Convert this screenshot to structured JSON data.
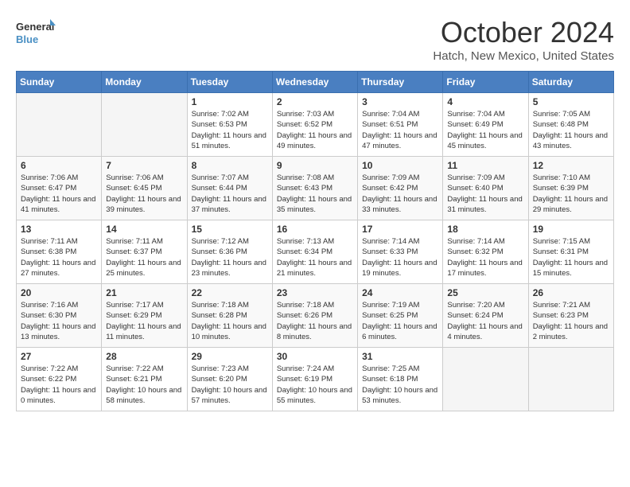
{
  "header": {
    "logo_line1": "General",
    "logo_line2": "Blue",
    "month": "October 2024",
    "location": "Hatch, New Mexico, United States"
  },
  "weekdays": [
    "Sunday",
    "Monday",
    "Tuesday",
    "Wednesday",
    "Thursday",
    "Friday",
    "Saturday"
  ],
  "weeks": [
    [
      {
        "day": "",
        "empty": true
      },
      {
        "day": "",
        "empty": true
      },
      {
        "day": "1",
        "sunrise": "Sunrise: 7:02 AM",
        "sunset": "Sunset: 6:53 PM",
        "daylight": "Daylight: 11 hours and 51 minutes."
      },
      {
        "day": "2",
        "sunrise": "Sunrise: 7:03 AM",
        "sunset": "Sunset: 6:52 PM",
        "daylight": "Daylight: 11 hours and 49 minutes."
      },
      {
        "day": "3",
        "sunrise": "Sunrise: 7:04 AM",
        "sunset": "Sunset: 6:51 PM",
        "daylight": "Daylight: 11 hours and 47 minutes."
      },
      {
        "day": "4",
        "sunrise": "Sunrise: 7:04 AM",
        "sunset": "Sunset: 6:49 PM",
        "daylight": "Daylight: 11 hours and 45 minutes."
      },
      {
        "day": "5",
        "sunrise": "Sunrise: 7:05 AM",
        "sunset": "Sunset: 6:48 PM",
        "daylight": "Daylight: 11 hours and 43 minutes."
      }
    ],
    [
      {
        "day": "6",
        "sunrise": "Sunrise: 7:06 AM",
        "sunset": "Sunset: 6:47 PM",
        "daylight": "Daylight: 11 hours and 41 minutes."
      },
      {
        "day": "7",
        "sunrise": "Sunrise: 7:06 AM",
        "sunset": "Sunset: 6:45 PM",
        "daylight": "Daylight: 11 hours and 39 minutes."
      },
      {
        "day": "8",
        "sunrise": "Sunrise: 7:07 AM",
        "sunset": "Sunset: 6:44 PM",
        "daylight": "Daylight: 11 hours and 37 minutes."
      },
      {
        "day": "9",
        "sunrise": "Sunrise: 7:08 AM",
        "sunset": "Sunset: 6:43 PM",
        "daylight": "Daylight: 11 hours and 35 minutes."
      },
      {
        "day": "10",
        "sunrise": "Sunrise: 7:09 AM",
        "sunset": "Sunset: 6:42 PM",
        "daylight": "Daylight: 11 hours and 33 minutes."
      },
      {
        "day": "11",
        "sunrise": "Sunrise: 7:09 AM",
        "sunset": "Sunset: 6:40 PM",
        "daylight": "Daylight: 11 hours and 31 minutes."
      },
      {
        "day": "12",
        "sunrise": "Sunrise: 7:10 AM",
        "sunset": "Sunset: 6:39 PM",
        "daylight": "Daylight: 11 hours and 29 minutes."
      }
    ],
    [
      {
        "day": "13",
        "sunrise": "Sunrise: 7:11 AM",
        "sunset": "Sunset: 6:38 PM",
        "daylight": "Daylight: 11 hours and 27 minutes."
      },
      {
        "day": "14",
        "sunrise": "Sunrise: 7:11 AM",
        "sunset": "Sunset: 6:37 PM",
        "daylight": "Daylight: 11 hours and 25 minutes."
      },
      {
        "day": "15",
        "sunrise": "Sunrise: 7:12 AM",
        "sunset": "Sunset: 6:36 PM",
        "daylight": "Daylight: 11 hours and 23 minutes."
      },
      {
        "day": "16",
        "sunrise": "Sunrise: 7:13 AM",
        "sunset": "Sunset: 6:34 PM",
        "daylight": "Daylight: 11 hours and 21 minutes."
      },
      {
        "day": "17",
        "sunrise": "Sunrise: 7:14 AM",
        "sunset": "Sunset: 6:33 PM",
        "daylight": "Daylight: 11 hours and 19 minutes."
      },
      {
        "day": "18",
        "sunrise": "Sunrise: 7:14 AM",
        "sunset": "Sunset: 6:32 PM",
        "daylight": "Daylight: 11 hours and 17 minutes."
      },
      {
        "day": "19",
        "sunrise": "Sunrise: 7:15 AM",
        "sunset": "Sunset: 6:31 PM",
        "daylight": "Daylight: 11 hours and 15 minutes."
      }
    ],
    [
      {
        "day": "20",
        "sunrise": "Sunrise: 7:16 AM",
        "sunset": "Sunset: 6:30 PM",
        "daylight": "Daylight: 11 hours and 13 minutes."
      },
      {
        "day": "21",
        "sunrise": "Sunrise: 7:17 AM",
        "sunset": "Sunset: 6:29 PM",
        "daylight": "Daylight: 11 hours and 11 minutes."
      },
      {
        "day": "22",
        "sunrise": "Sunrise: 7:18 AM",
        "sunset": "Sunset: 6:28 PM",
        "daylight": "Daylight: 11 hours and 10 minutes."
      },
      {
        "day": "23",
        "sunrise": "Sunrise: 7:18 AM",
        "sunset": "Sunset: 6:26 PM",
        "daylight": "Daylight: 11 hours and 8 minutes."
      },
      {
        "day": "24",
        "sunrise": "Sunrise: 7:19 AM",
        "sunset": "Sunset: 6:25 PM",
        "daylight": "Daylight: 11 hours and 6 minutes."
      },
      {
        "day": "25",
        "sunrise": "Sunrise: 7:20 AM",
        "sunset": "Sunset: 6:24 PM",
        "daylight": "Daylight: 11 hours and 4 minutes."
      },
      {
        "day": "26",
        "sunrise": "Sunrise: 7:21 AM",
        "sunset": "Sunset: 6:23 PM",
        "daylight": "Daylight: 11 hours and 2 minutes."
      }
    ],
    [
      {
        "day": "27",
        "sunrise": "Sunrise: 7:22 AM",
        "sunset": "Sunset: 6:22 PM",
        "daylight": "Daylight: 11 hours and 0 minutes."
      },
      {
        "day": "28",
        "sunrise": "Sunrise: 7:22 AM",
        "sunset": "Sunset: 6:21 PM",
        "daylight": "Daylight: 10 hours and 58 minutes."
      },
      {
        "day": "29",
        "sunrise": "Sunrise: 7:23 AM",
        "sunset": "Sunset: 6:20 PM",
        "daylight": "Daylight: 10 hours and 57 minutes."
      },
      {
        "day": "30",
        "sunrise": "Sunrise: 7:24 AM",
        "sunset": "Sunset: 6:19 PM",
        "daylight": "Daylight: 10 hours and 55 minutes."
      },
      {
        "day": "31",
        "sunrise": "Sunrise: 7:25 AM",
        "sunset": "Sunset: 6:18 PM",
        "daylight": "Daylight: 10 hours and 53 minutes."
      },
      {
        "day": "",
        "empty": true
      },
      {
        "day": "",
        "empty": true
      }
    ]
  ]
}
